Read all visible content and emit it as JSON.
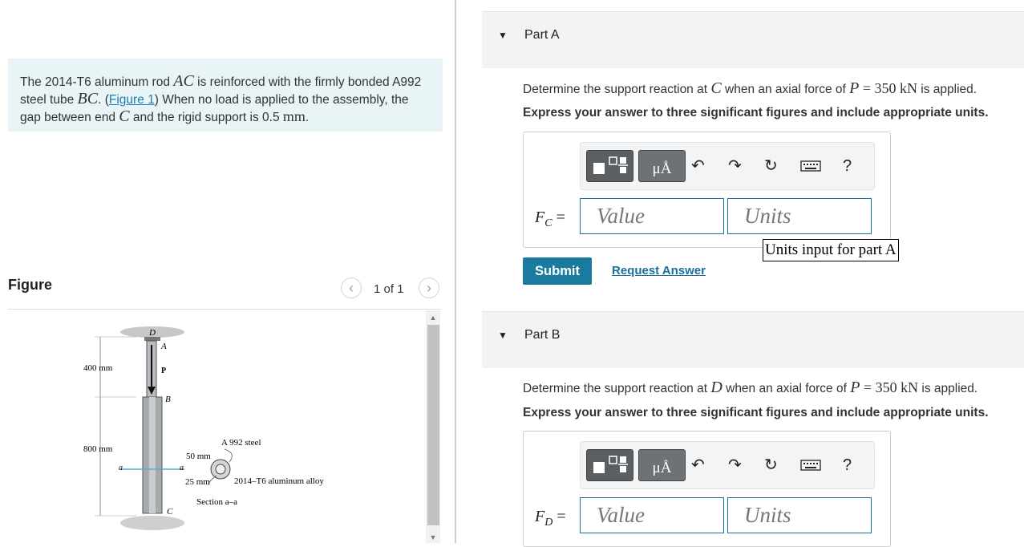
{
  "problem": {
    "text_1": "The 2014-T6 aluminum rod ",
    "m_AC": "AC",
    "text_2": " is reinforced with the firmly bonded A992 steel tube ",
    "m_BC": "BC",
    "text_3": ". (",
    "figure_link": "Figure 1",
    "text_4": ") When no load is applied to the assembly, the gap between end ",
    "m_C": "C",
    "text_5": " and the rigid support is 0.5 ",
    "m_mm": "mm",
    "text_6": "."
  },
  "figure": {
    "title": "Figure",
    "counter": "1 of 1",
    "prev_icon": "chevron-left-icon",
    "next_icon": "chevron-right-icon",
    "labels": {
      "D": "D",
      "A": "A",
      "P": "P",
      "B": "B",
      "C": "C",
      "a_left": "a",
      "a_right": "a",
      "dim_400": "400 mm",
      "dim_800": "800 mm",
      "dim_50": "50 mm",
      "dim_25": "25 mm",
      "steel": "A 992 steel",
      "alloy": "2014–T6 aluminum alloy",
      "section": "Section a–a"
    }
  },
  "partA": {
    "title": "Part A",
    "q_1": "Determine the support reaction at ",
    "q_point": "C",
    "q_2": " when an axial force of ",
    "q_P": "P",
    "q_eq": " = 350 kN",
    "q_3": " is applied.",
    "instruction": "Express your answer to three significant figures and include appropriate units.",
    "label_main": "F",
    "label_sub": "C",
    "label_eq": " =",
    "value_placeholder": "Value",
    "units_placeholder": "Units",
    "units_tooltip": "Units input for part A",
    "submit": "Submit",
    "request_answer": "Request Answer"
  },
  "partB": {
    "title": "Part B",
    "q_1": "Determine the support reaction at ",
    "q_point": "D",
    "q_2": " when an axial force of ",
    "q_P": "P",
    "q_eq": " = 350 kN",
    "q_3": " is applied.",
    "instruction": "Express your answer to three significant figures and include appropriate units.",
    "label_main": "F",
    "label_sub": "D",
    "label_eq": " =",
    "value_placeholder": "Value",
    "units_placeholder": "Units"
  },
  "toolbar": {
    "templates_icon": "templates-icon",
    "mu_label": "μÅ",
    "undo_icon": "undo-icon",
    "redo_icon": "redo-icon",
    "reset_icon": "reset-icon",
    "keyboard_icon": "keyboard-icon",
    "help_label": "?"
  }
}
